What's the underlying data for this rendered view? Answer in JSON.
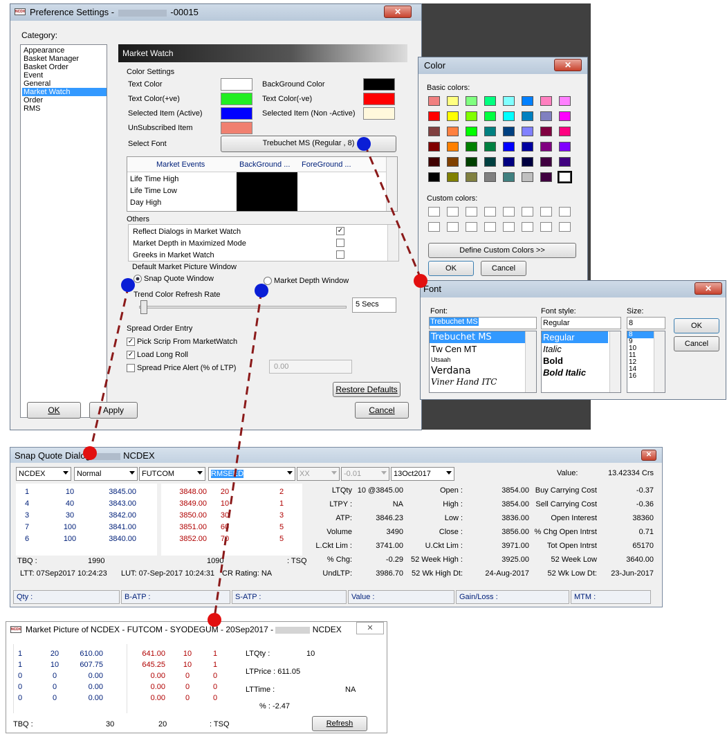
{
  "pref": {
    "title": "Preference Settings -",
    "title_suffix": "-00015",
    "category_label": "Category:",
    "categories": [
      "Appearance",
      "Basket Manager",
      "Basket Order",
      "Event",
      "General",
      "Market Watch",
      "Order",
      "RMS"
    ],
    "selected_category": "Market Watch",
    "section_title": "Market Watch",
    "color_settings": {
      "title": "Color Settings",
      "text_color": "Text Color",
      "background_color": "BackGround Color",
      "text_color_pos": "Text Color(+ve)",
      "text_color_neg": "Text Color(-ve)",
      "selected_active": "Selected Item (Active)",
      "selected_nonactive": "Selected Item (Non -Active)",
      "unsubscribed": "UnSubscribed Item",
      "select_font": "Select Font",
      "font_button": "Trebuchet MS (Regular , 8)",
      "colors": {
        "text": "#ffffff",
        "background": "#000000",
        "pos": "#22ee22",
        "neg": "#ff0000",
        "active": "#0000ff",
        "nonactive": "#fff8dc",
        "unsub": "#f08070"
      }
    },
    "events_table": {
      "headers": [
        "Market Events",
        "BackGround ...",
        "ForeGround ..."
      ],
      "rows": [
        "Life Time High",
        "Life Time Low",
        "Day High"
      ]
    },
    "others": {
      "title": "Others",
      "items": [
        {
          "label": "Reflect Dialogs in Market Watch",
          "checked": "✓"
        },
        {
          "label": "Market Depth in Maximized Mode",
          "checked": ""
        },
        {
          "label": "Greeks in Market Watch",
          "checked": ""
        }
      ]
    },
    "default_window": {
      "title": "Default Market Picture Window",
      "snap": "Snap Quote Window",
      "depth": "Market Depth Window"
    },
    "trend": {
      "label": "Trend Color Refresh Rate",
      "value": "5 Secs"
    },
    "spread": {
      "title": "Spread Order Entry",
      "pick": "Pick Scrip From MarketWatch",
      "long_roll": "Load Long Roll",
      "alert": "Spread Price Alert (% of LTP)",
      "alert_value": "0.00"
    },
    "restore": "Restore Defaults",
    "ok": "OK",
    "apply": "Apply",
    "cancel": "Cancel"
  },
  "color_dialog": {
    "title": "Color",
    "basic_label": "Basic colors:",
    "custom_label": "Custom colors:",
    "define": "Define Custom Colors >>",
    "ok": "OK",
    "cancel": "Cancel",
    "basic_colors": [
      "#f08080",
      "#ffff80",
      "#80ff80",
      "#00ff80",
      "#80ffff",
      "#0080ff",
      "#ff80c0",
      "#ff80ff",
      "#ff0000",
      "#ffff00",
      "#80ff00",
      "#00ff40",
      "#00ffff",
      "#0080c0",
      "#8080c0",
      "#ff00ff",
      "#804040",
      "#ff8040",
      "#00ff00",
      "#008080",
      "#004080",
      "#8080ff",
      "#800040",
      "#ff0080",
      "#800000",
      "#ff8000",
      "#008000",
      "#008040",
      "#0000ff",
      "#0000a0",
      "#800080",
      "#8000ff",
      "#400000",
      "#804000",
      "#004000",
      "#004040",
      "#000080",
      "#000040",
      "#400040",
      "#400080",
      "#000000",
      "#808000",
      "#808040",
      "#808080",
      "#408080",
      "#c0c0c0",
      "#400040",
      "#ffffff"
    ]
  },
  "font_dialog": {
    "title": "Font",
    "font_label": "Font:",
    "style_label": "Font style:",
    "size_label": "Size:",
    "font_value": "Trebuchet MS",
    "style_value": "Regular",
    "size_value": "8",
    "fonts": [
      "Trebuchet MS",
      "Tw Cen MT",
      "Utsaah",
      "Verdana",
      "Viner Hand ITC"
    ],
    "styles": [
      "Regular",
      "Italic",
      "Bold",
      "Bold Italic"
    ],
    "sizes": [
      "8",
      "9",
      "10",
      "11",
      "12",
      "14",
      "16"
    ],
    "ok": "OK",
    "cancel": "Cancel"
  },
  "snap": {
    "title": "Snap Quote Dialog",
    "title_suffix": "NCDEX",
    "exchange": "NCDEX",
    "market": "Normal",
    "instrument": "FUTCOM",
    "symbol": "RMSEED",
    "option": "XX",
    "strike": "-0.01",
    "expiry": "13Oct2017",
    "value_label": "Value:",
    "value": "13.42334 Crs",
    "bids": [
      [
        "1",
        "10",
        "3845.00"
      ],
      [
        "4",
        "40",
        "3843.00"
      ],
      [
        "3",
        "30",
        "3842.00"
      ],
      [
        "7",
        "100",
        "3841.00"
      ],
      [
        "6",
        "100",
        "3840.00"
      ]
    ],
    "asks": [
      [
        "3848.00",
        "20",
        "2"
      ],
      [
        "3849.00",
        "10",
        "1"
      ],
      [
        "3850.00",
        "30",
        "3"
      ],
      [
        "3851.00",
        "60",
        "5"
      ],
      [
        "3852.00",
        "70",
        "5"
      ]
    ],
    "mid": [
      [
        "LTQty",
        "10 @3845.00",
        "Open :",
        "3854.00"
      ],
      [
        "LTPY :",
        "NA",
        "High :",
        "3854.00"
      ],
      [
        "ATP:",
        "3846.23",
        "Low :",
        "3836.00"
      ],
      [
        "Volume",
        "3490",
        "Close :",
        "3856.00"
      ],
      [
        "L.Ckt Lim :",
        "3741.00",
        "U.Ckt Lim :",
        "3971.00"
      ],
      [
        "% Chg:",
        "-0.29",
        "52 Week High :",
        "3925.00"
      ],
      [
        "UndLTP:",
        "3986.70",
        "52 Wk High Dt:",
        "24-Aug-2017"
      ]
    ],
    "right": [
      [
        "Buy Carrying Cost",
        "-0.37"
      ],
      [
        "Sell Carrying Cost",
        "-0.36"
      ],
      [
        "Open Interest",
        "38360"
      ],
      [
        "% Chg Open Intrst",
        "0.71"
      ],
      [
        "Tot Open Intrst",
        "65170"
      ],
      [
        "52 Week Low",
        "3640.00"
      ],
      [
        "52 Wk Low Dt:",
        "23-Jun-2017"
      ]
    ],
    "tbq_label": "TBQ :",
    "tbq": "1990",
    "tsq": "1090",
    "tsq_label": ": TSQ",
    "ltt": "LTT: 07Sep2017 10:24:23",
    "lut": "LUT: 07-Sep-2017 10:24:31",
    "cr": "CR Rating: NA",
    "status": [
      "Qty :",
      "B-ATP :",
      "S-ATP :",
      "Value :",
      "Gain/Loss :",
      "MTM :"
    ]
  },
  "depth": {
    "title": "Market Picture of NCDEX - FUTCOM - SYODEGUM - 20Sep2017 -",
    "title_suffix": "NCDEX",
    "bids": [
      [
        "1",
        "20",
        "610.00"
      ],
      [
        "1",
        "10",
        "607.75"
      ],
      [
        "0",
        "0",
        "0.00"
      ],
      [
        "0",
        "0",
        "0.00"
      ],
      [
        "0",
        "0",
        "0.00"
      ]
    ],
    "asks": [
      [
        "641.00",
        "10",
        "1"
      ],
      [
        "645.25",
        "10",
        "1"
      ],
      [
        "0.00",
        "0",
        "0"
      ],
      [
        "0.00",
        "0",
        "0"
      ],
      [
        "0.00",
        "0",
        "0"
      ]
    ],
    "ltqty_label": "LTQty :",
    "ltqty": "10",
    "ltprice": "LTPrice : 611.05",
    "lttime_label": "LTTime :",
    "lttime": "NA",
    "pct": "% :  -2.47",
    "tbq_label": "TBQ :",
    "tbq": "30",
    "tsq": "20",
    "tsq_label": ": TSQ",
    "refresh": "Refresh"
  }
}
